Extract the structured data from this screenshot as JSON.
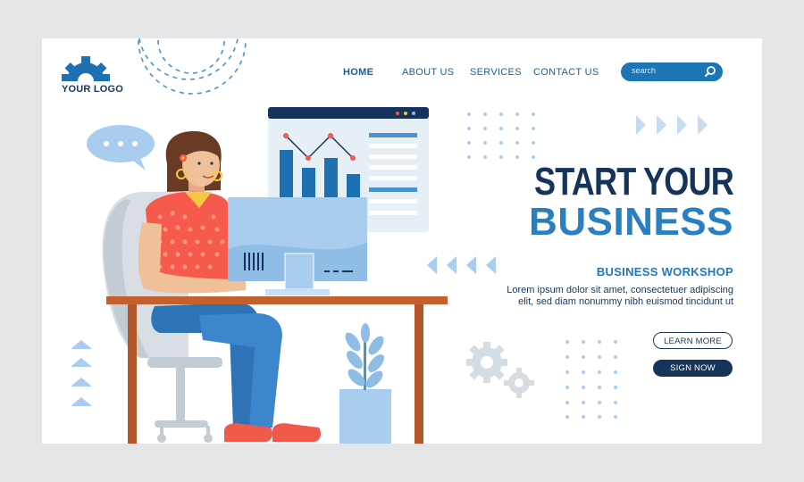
{
  "logo": {
    "text": "YOUR LOGO",
    "icon": "gear-icon"
  },
  "nav": {
    "items": [
      {
        "label": "HOME",
        "active": true
      },
      {
        "label": "ABOUT US",
        "active": false
      },
      {
        "label": "SERVICES",
        "active": false
      },
      {
        "label": "CONTACT US",
        "active": false
      }
    ]
  },
  "search": {
    "placeholder": "search",
    "icon": "search-icon"
  },
  "hero": {
    "title_line1": "START YOUR",
    "title_line2": "BUSINESS",
    "subtitle": "BUSINESS WORKSHOP",
    "paragraph": "Lorem ipsum dolor sit amet, consectetuer adipiscing elit, sed diam nonummy nibh euismod tincidunt ut",
    "learn_more_label": "LEARN MORE",
    "sign_now_label": "SIGN NOW"
  },
  "colors": {
    "navy": "#16345a",
    "blue": "#2a7fc0",
    "light_blue": "#a9cdee",
    "skin": "#f0c198",
    "shirt": "#f65a4c",
    "desk": "#c45f2e"
  }
}
